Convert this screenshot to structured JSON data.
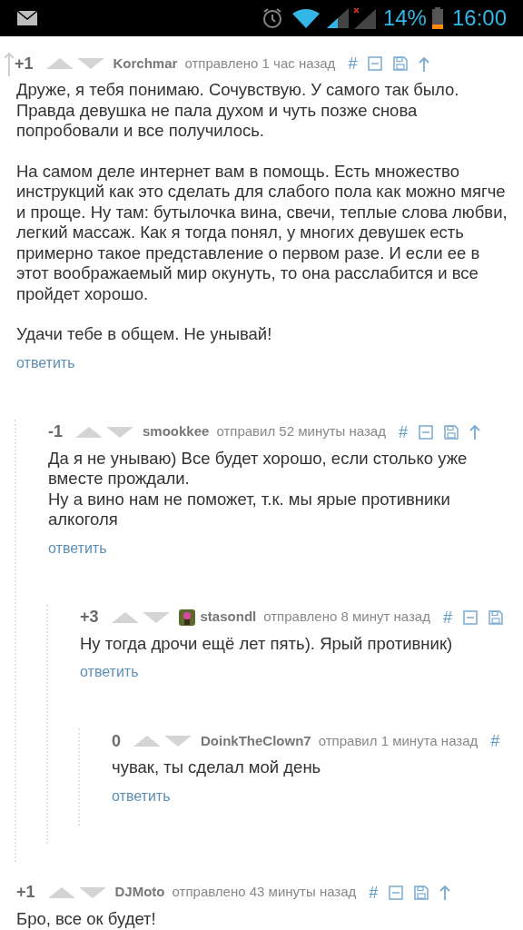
{
  "status_bar": {
    "battery": "14%",
    "time": "16:00"
  },
  "comments": [
    {
      "score": "+1",
      "parent_arrow": true,
      "avatar": false,
      "user": "Korchmar",
      "verb": "отправлено",
      "time": "1 час назад",
      "actions": [
        {
          "kind": "link",
          "text": "#"
        },
        {
          "kind": "collapse"
        },
        {
          "kind": "save"
        },
        {
          "kind": "up"
        }
      ],
      "blank_lines": true,
      "paragraphs": [
        "Друже, я тебя понимаю. Сочувствую. У самого так было. Правда девушка не пала духом и чуть позже снова попробовали и все получилось.",
        "На самом деле интернет вам в помощь. Есть множество инструкций как это сделать для слабого пола как можно мягче и проще. Ну там: бутылочка вина, свечи, теплые слова любви, легкий массаж. Как я тогда понял, у многих девушек есть примерно такое представление о первом разе. И если ее в этот воображаемый мир окунуть, то она расслабится и все пройдет хорошо.",
        "Удачи тебе в общем. Не унывай!"
      ],
      "reply": "ответить",
      "children": [
        {
          "score": "-1",
          "parent_arrow": false,
          "avatar": false,
          "user": "smookkee",
          "verb": "отправил",
          "time": "52 минуты назад",
          "actions": [
            {
              "kind": "link",
              "text": "#"
            },
            {
              "kind": "collapse"
            },
            {
              "kind": "save"
            },
            {
              "kind": "up"
            }
          ],
          "blank_lines": false,
          "paragraphs": [
            "Да я не унываю) Все будет хорошо, если столько уже вместе прождали.",
            "Ну а вино нам не поможет, т.к. мы ярые противники алкоголя"
          ],
          "reply": "ответить",
          "children": [
            {
              "score": "+3",
              "parent_arrow": false,
              "avatar": true,
              "user": "stasondl",
              "verb": "отправлено",
              "time": "8 минут назад",
              "actions": [
                {
                  "kind": "link",
                  "text": "#"
                },
                {
                  "kind": "collapse"
                },
                {
                  "kind": "save"
                }
              ],
              "paragraphs": [
                "Ну тогда дрочи ещё лет пять). Ярый противник)"
              ],
              "reply": "ответить",
              "children": [
                {
                  "score": "0",
                  "parent_arrow": false,
                  "avatar": false,
                  "user": "DoinkTheClown7",
                  "verb": "отправил",
                  "time": "1 минута назад",
                  "actions": [
                    {
                      "kind": "link",
                      "text": "#"
                    }
                  ],
                  "paragraphs": [
                    "чувак, ты сделал мой день"
                  ],
                  "reply": "ответить"
                }
              ]
            }
          ]
        }
      ]
    },
    {
      "score": "+1",
      "parent_arrow": false,
      "avatar": false,
      "user": "DJMoto",
      "verb": "отправлено",
      "time": "43 минуты назад",
      "actions": [
        {
          "kind": "link",
          "text": "#"
        },
        {
          "kind": "collapse"
        },
        {
          "kind": "save"
        },
        {
          "kind": "up"
        }
      ],
      "paragraphs": [
        "Бро, все ок будет!"
      ]
    }
  ]
}
